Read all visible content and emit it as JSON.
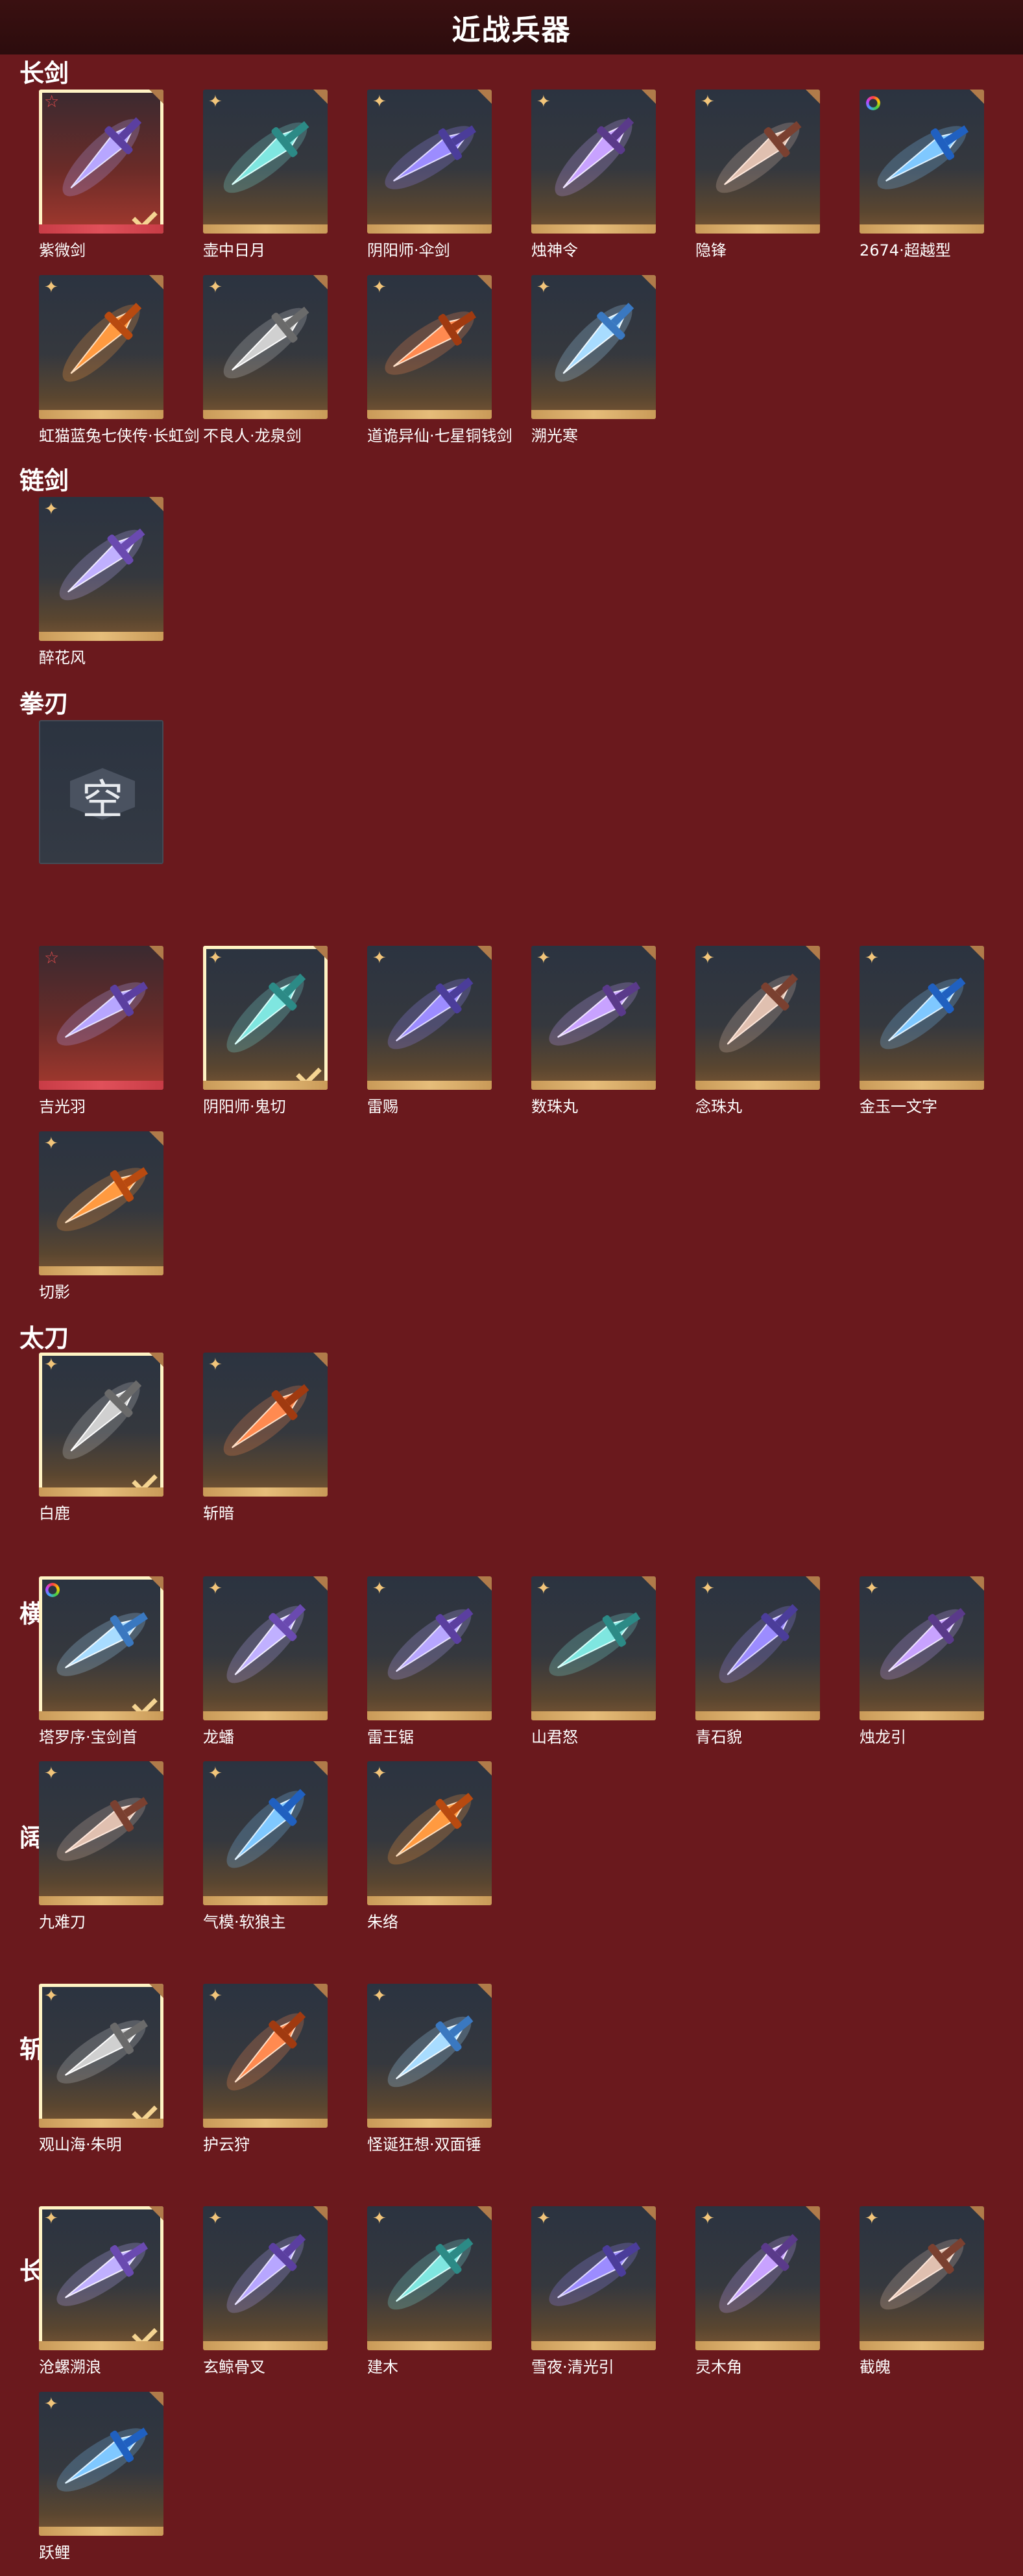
{
  "page": {
    "title": "近战兵器"
  },
  "icons": {
    "quality_gold": "quality-star-gold",
    "quality_red": "quality-star-red",
    "quality_rainbow": "quality-rainbow-ring",
    "equipped": "check-icon"
  },
  "colors": {
    "background": "#6a191d",
    "titlebar": "#2c0c0d",
    "gold": "#e6bd7a",
    "red": "#c83c46"
  },
  "sections": [
    {
      "name": "长剑",
      "items": [
        {
          "label": "紫微剑",
          "tier": "red",
          "equipped": true
        },
        {
          "label": "壶中日月",
          "tier": "gold",
          "equipped": false
        },
        {
          "label": "阴阳师·伞剑",
          "tier": "gold",
          "equipped": false
        },
        {
          "label": "烛神令",
          "tier": "gold",
          "equipped": false
        },
        {
          "label": "隐锋",
          "tier": "gold",
          "equipped": false
        },
        {
          "label": "2674·超越型",
          "tier": "rainbow",
          "equipped": false
        },
        {
          "label": "虹猫蓝兔七侠传·长虹剑",
          "tier": "gold",
          "equipped": false
        },
        {
          "label": "不良人·龙泉剑",
          "tier": "gold",
          "equipped": false
        },
        {
          "label": "道诡异仙·七星铜钱剑",
          "tier": "gold",
          "equipped": false
        },
        {
          "label": "溯光寒",
          "tier": "gold",
          "equipped": false
        }
      ]
    },
    {
      "name": "链剑",
      "items": [
        {
          "label": "醉花风",
          "tier": "gold",
          "equipped": false
        }
      ]
    },
    {
      "name": "拳刃",
      "empty_text": "空",
      "items": []
    },
    {
      "name": "太刀",
      "items": [
        {
          "label": "吉光羽",
          "tier": "red",
          "equipped": false
        },
        {
          "label": "阴阳师·鬼切",
          "tier": "gold",
          "equipped": true
        },
        {
          "label": "雷赐",
          "tier": "gold",
          "equipped": false
        },
        {
          "label": "数珠丸",
          "tier": "gold",
          "equipped": false
        },
        {
          "label": "念珠丸",
          "tier": "gold",
          "equipped": false
        },
        {
          "label": "金玉一文字",
          "tier": "gold",
          "equipped": false
        },
        {
          "label": "切影",
          "tier": "gold",
          "equipped": false
        }
      ]
    },
    {
      "name": "横刀",
      "items": [
        {
          "label": "白鹿",
          "tier": "gold",
          "equipped": true
        },
        {
          "label": "斩暗",
          "tier": "gold",
          "equipped": false
        }
      ]
    },
    {
      "name": "阔刀",
      "items": [
        {
          "label": "塔罗序·宝剑首",
          "tier": "rainbow",
          "equipped": true
        },
        {
          "label": "龙蟠",
          "tier": "gold",
          "equipped": false
        },
        {
          "label": "雷王锯",
          "tier": "gold",
          "equipped": false
        },
        {
          "label": "山君怒",
          "tier": "gold",
          "equipped": false
        },
        {
          "label": "青石貌",
          "tier": "gold",
          "equipped": false
        },
        {
          "label": "烛龙引",
          "tier": "gold",
          "equipped": false
        },
        {
          "label": "九难刀",
          "tier": "gold",
          "equipped": false
        },
        {
          "label": "气模·软狼主",
          "tier": "gold",
          "equipped": false
        },
        {
          "label": "朱络",
          "tier": "gold",
          "equipped": false
        }
      ]
    },
    {
      "name": "斩马刀",
      "items": [
        {
          "label": "观山海·朱明",
          "tier": "gold",
          "equipped": true
        },
        {
          "label": "护云狩",
          "tier": "gold",
          "equipped": false
        },
        {
          "label": "怪诞狂想·双面锤",
          "tier": "gold",
          "equipped": false
        }
      ]
    },
    {
      "name": "长枪",
      "items": [
        {
          "label": "沧螺溯浪",
          "tier": "gold",
          "equipped": true
        },
        {
          "label": "玄鲸骨叉",
          "tier": "gold",
          "equipped": false
        },
        {
          "label": "建木",
          "tier": "gold",
          "equipped": false
        },
        {
          "label": "雪夜·清光引",
          "tier": "gold",
          "equipped": false
        },
        {
          "label": "灵木角",
          "tier": "gold",
          "equipped": false
        },
        {
          "label": "截魄",
          "tier": "gold",
          "equipped": false
        },
        {
          "label": "跃鲤",
          "tier": "gold",
          "equipped": false
        }
      ]
    }
  ]
}
